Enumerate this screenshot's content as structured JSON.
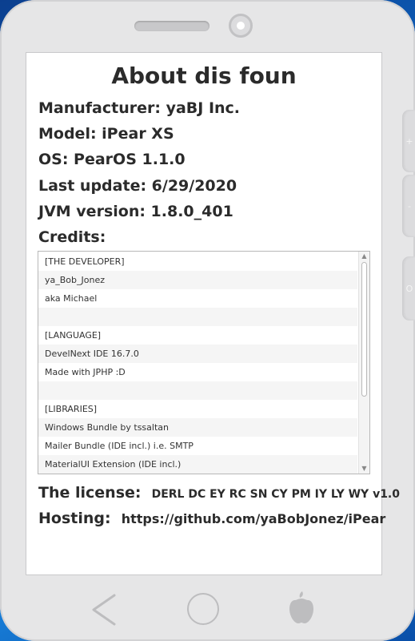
{
  "screen": {
    "title": "About dis foun",
    "info": {
      "manufacturer": "Manufacturer: yaBJ Inc.",
      "model": "Model: iPear XS",
      "os": "OS: PearOS 1.1.0",
      "last_update": "Last update: 6/29/2020",
      "jvm": "JVM version: 1.8.0_401",
      "credits_label": "Credits:"
    },
    "credits": [
      "[THE DEVELOPER]",
      "ya_Bob_Jonez",
      "aka Michael",
      "",
      "[LANGUAGE]",
      "DevelNext IDE 16.7.0",
      "Made with JPHP :D",
      "",
      "[LIBRARIES]",
      "Windows Bundle by tssaltan",
      "Mailer Bundle (IDE incl.) i.e. SMTP",
      "MaterialUI Extension (IDE incl.)"
    ],
    "license_label": "The license:",
    "license_value": "DERL DC EY RC SN CY PM IY LY WY v1.0",
    "hosting_label": "Hosting:",
    "hosting_value": "https://github.com/yaBobJonez/iPear"
  },
  "side_buttons": {
    "plus": "+",
    "minus": "-",
    "o": "O"
  },
  "nav": {
    "back_icon": "chevron-left-icon",
    "home_icon": "circle-home-icon",
    "apple_icon": "pear-logo-icon"
  },
  "colors": {
    "phone_body": "#e6e6e7",
    "screen_bg": "#ffffff",
    "text": "#2b2b2b"
  }
}
